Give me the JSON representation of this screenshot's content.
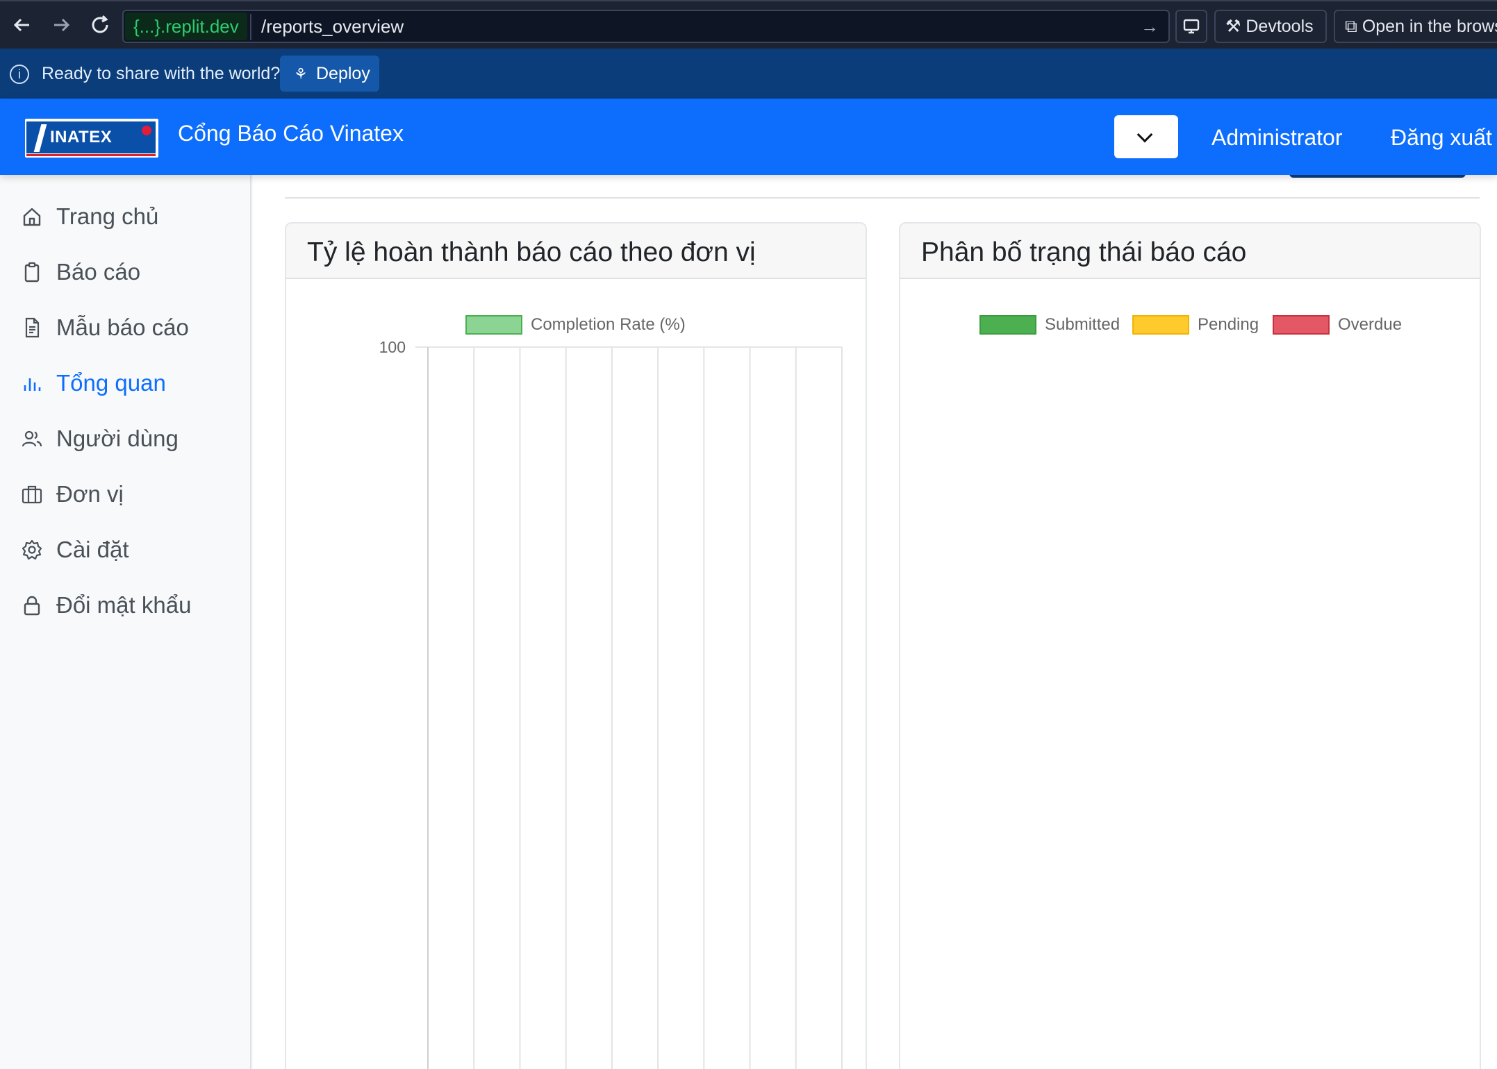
{
  "browser": {
    "back_icon": "arrow-left-icon",
    "forward_icon": "arrow-right-icon",
    "reload_icon": "reload-icon",
    "url_domain": "{...}.replit.dev",
    "url_path": "/reports_overview",
    "devtools_label": "Devtools",
    "open_label": "Open in the brows"
  },
  "deploy_bar": {
    "message": "Ready to share with the world?",
    "deploy_label": "Deploy"
  },
  "header": {
    "logo_text": "INATEX",
    "title": "Cổng Báo Cáo Vinatex",
    "user": "Administrator",
    "logout": "Đăng xuất"
  },
  "sidebar": {
    "items": [
      {
        "label": "Trang chủ",
        "icon": "home-icon"
      },
      {
        "label": "Báo cáo",
        "icon": "clipboard-icon"
      },
      {
        "label": "Mẫu báo cáo",
        "icon": "document-icon"
      },
      {
        "label": "Tổng quan",
        "icon": "bar-chart-icon",
        "active": true
      },
      {
        "label": "Người dùng",
        "icon": "users-icon"
      },
      {
        "label": "Đơn vị",
        "icon": "building-icon"
      },
      {
        "label": "Cài đặt",
        "icon": "gear-icon"
      },
      {
        "label": "Đổi mật khẩu",
        "icon": "lock-icon"
      }
    ]
  },
  "cards": {
    "completion": {
      "title": "Tỷ lệ hoàn thành báo cáo theo đơn vị"
    },
    "status": {
      "title": "Phân bố trạng thái báo cáo"
    }
  },
  "colors": {
    "primary": "#0d6efd",
    "submitted": "#4caf50",
    "pending": "#ffc107",
    "overdue": "#dc3545"
  },
  "chart_data": [
    {
      "type": "bar",
      "title": "",
      "series": [
        {
          "name": "Completion Rate (%)",
          "values": []
        }
      ],
      "categories_count": 9,
      "y_ticks": [
        "100"
      ],
      "ylim": [
        0,
        100
      ],
      "grid": true,
      "legend": "top"
    },
    {
      "type": "pie",
      "title": "",
      "labels": [
        "Submitted",
        "Pending",
        "Overdue"
      ],
      "values": [],
      "legend": "top"
    }
  ]
}
